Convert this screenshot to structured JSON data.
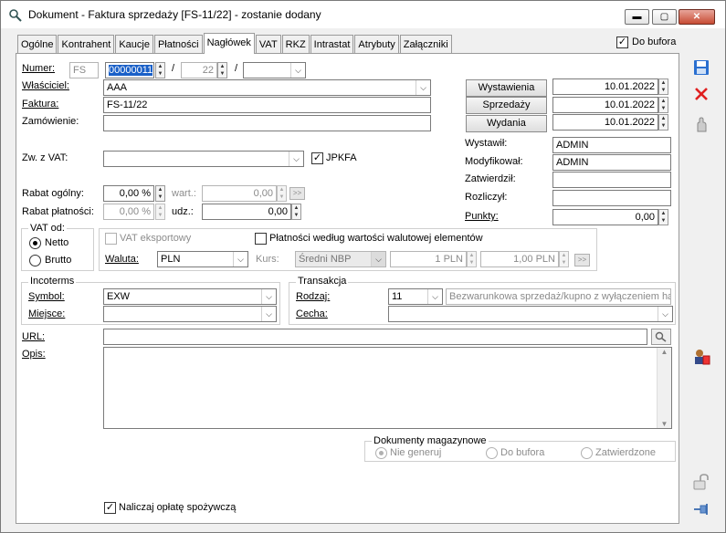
{
  "window": {
    "title": "Dokument - Faktura sprzedaży [FS-11/22]  - zostanie dodany",
    "minimize": "▬",
    "maximize": "▢",
    "close": "✕"
  },
  "tabs": [
    "Ogólne",
    "Kontrahent",
    "Kaucje",
    "Płatności",
    "Nagłówek",
    "VAT",
    "RKZ",
    "Intrastat",
    "Atrybuty",
    "Załączniki"
  ],
  "active_tab": "Nagłówek",
  "do_bufora": {
    "label": "Do bufora",
    "checked": true
  },
  "numer": {
    "label": "Numer:",
    "prefix": "FS",
    "value": "00000011",
    "sep1": "/",
    "year": "22",
    "sep2": "/",
    "series": ""
  },
  "wlasciciel": {
    "label": "Właściciel:",
    "value": "AAA"
  },
  "faktura": {
    "label": "Faktura:",
    "value": "FS-11/22"
  },
  "zamowienie": {
    "label": "Zamówienie:",
    "value": ""
  },
  "dates": {
    "wystawienia": {
      "label": "Wystawienia",
      "value": "10.01.2022"
    },
    "sprzedazy": {
      "label": "Sprzedaży",
      "value": "10.01.2022"
    },
    "wydania": {
      "label": "Wydania",
      "value": "10.01.2022"
    }
  },
  "wystawil": {
    "label": "Wystawił:",
    "value": "ADMIN"
  },
  "modyfikowal": {
    "label": "Modyfikował:",
    "value": "ADMIN"
  },
  "zatwierdzil": {
    "label": "Zatwierdził:",
    "value": ""
  },
  "rozliczyl": {
    "label": "Rozliczył:",
    "value": ""
  },
  "punkty": {
    "label": "Punkty:",
    "value": "0,00"
  },
  "zw_vat": {
    "label": "Zw. z VAT:",
    "value": ""
  },
  "jpkfa": {
    "label": "JPKFA",
    "checked": true
  },
  "rabat_ogolny": {
    "label": "Rabat ogólny:",
    "value": "0,00 %",
    "wart_label": "wart.:",
    "wart_value": "0,00",
    "arrow": ">>"
  },
  "rabat_platnosci": {
    "label": "Rabat płatności:",
    "value": "0,00 %",
    "udz_label": "udz.:",
    "udz_value": "0,00"
  },
  "vat_od": {
    "title": "VAT od:",
    "options": [
      "Netto",
      "Brutto"
    ],
    "selected": "Netto"
  },
  "vat_eksportowy": {
    "label": "VAT eksportowy",
    "checked": false
  },
  "platnosci_wartosci": {
    "label": "Płatności według wartości walutowej elementów",
    "checked": false
  },
  "waluta": {
    "label": "Waluta:",
    "value": "PLN"
  },
  "kurs": {
    "label": "Kurs:",
    "type": "Średni NBP",
    "v1": "1 PLN",
    "v2": "1,00 PLN",
    "arrow": ">>"
  },
  "incoterms": {
    "title": "Incoterms",
    "symbol_label": "Symbol:",
    "symbol": "EXW",
    "miejsce_label": "Miejsce:",
    "miejsce": ""
  },
  "transakcja": {
    "title": "Transakcja",
    "rodzaj_label": "Rodzaj:",
    "rodzaj": "11",
    "rodzaj_desc": "Bezwarunkowa sprzedaż/kupno z wyłączeniem ha",
    "cecha_label": "Cecha:",
    "cecha": ""
  },
  "url": {
    "label": "URL:",
    "value": ""
  },
  "opis": {
    "label": "Opis:",
    "value": ""
  },
  "dokumenty_magazynowe": {
    "title": "Dokumenty magazynowe",
    "options": [
      "Nie generuj",
      "Do bufora",
      "Zatwierdzone"
    ],
    "selected": "Nie generuj"
  },
  "oplata_spozywcza": {
    "label": "Naliczaj opłatę spożywczą",
    "checked": true
  }
}
